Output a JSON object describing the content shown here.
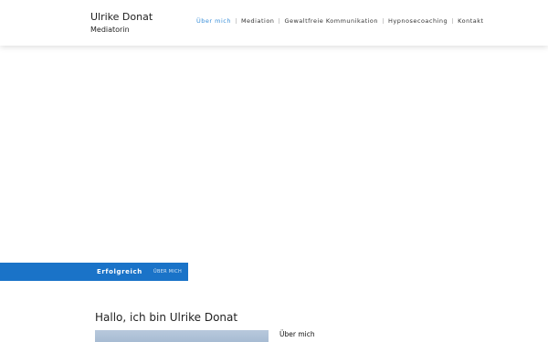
{
  "header": {
    "brand_name": "Ulrike Donat",
    "brand_subtitle": "Mediatorin"
  },
  "nav": {
    "items": [
      {
        "label": "Über mich",
        "active": true
      },
      {
        "label": "Mediation",
        "active": false
      },
      {
        "label": "Gewaltfreie Kommunikation",
        "active": false
      },
      {
        "label": "Hypnosecoaching",
        "active": false
      },
      {
        "label": "Kontakt",
        "active": false
      }
    ]
  },
  "breadcrumb": {
    "current": "Erfolgreich",
    "link": "ÜBER MICH"
  },
  "content": {
    "title": "Hallo, ich bin Ulrike Donat",
    "side_heading": "Über mich"
  },
  "colors": {
    "accent": "#3a8fd9",
    "breadcrumb_bg": "#1a73c8"
  }
}
